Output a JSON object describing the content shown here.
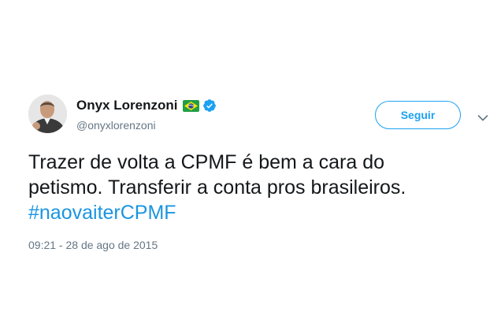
{
  "author": {
    "name": "Onyx Lorenzoni",
    "handle": "@onyxlorenzoni",
    "flag_icon": "brazil-flag-icon",
    "verified_icon": "verified-badge-icon"
  },
  "actions": {
    "follow_label": "Seguir",
    "menu_icon": "chevron-down-icon"
  },
  "tweet": {
    "line1": "Trazer de volta a CPMF é bem a cara do",
    "line2": "petismo. Transferir a conta pros brasileiros.",
    "hashtag": "#naovaiterCPMF"
  },
  "timestamp": "09:21 - 28 de ago de 2015",
  "colors": {
    "accent": "#1da1f2",
    "hashtag": "#1b95e0",
    "secondary_text": "#657786",
    "primary_text": "#14171a"
  }
}
